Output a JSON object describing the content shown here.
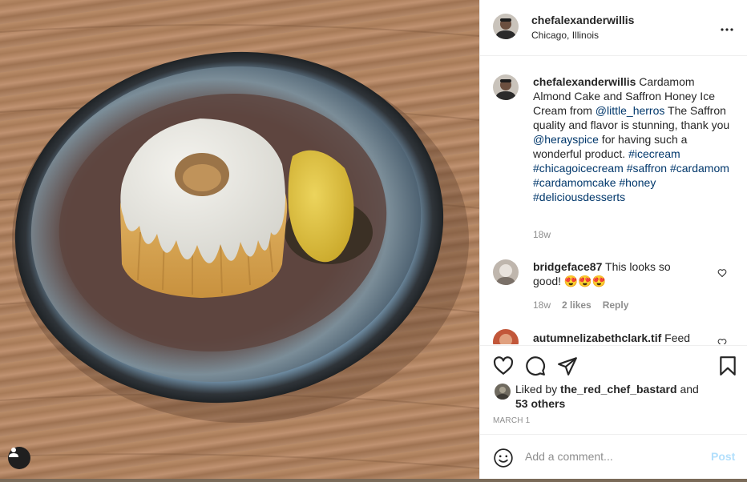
{
  "post": {
    "author": "chefalexanderwillis",
    "location": "Chicago, Illinois",
    "more_glyph": "•••"
  },
  "caption": {
    "author": "chefalexanderwillis",
    "text_1": " Cardamom Almond Cake and Saffron Honey Ice Cream from ",
    "mention_1": "@little_herros",
    "text_2": " The Saffron quality and flavor is stunning, thank you ",
    "mention_2": "@herayspice",
    "text_3": " for having such a wonderful product. ",
    "hashtags": [
      "#icecream",
      "#chicagoicecream",
      "#saffron",
      "#cardamom",
      "#cardamomcake",
      "#honey",
      "#deliciousdesserts"
    ],
    "time": "18w"
  },
  "comments": [
    {
      "author": "bridgeface87",
      "text": " This looks so good! 😍😍😍",
      "time": "18w",
      "likes": "2 likes",
      "reply": "Reply"
    },
    {
      "author": "autumnelizabethclark.tif",
      "text": " Feed"
    }
  ],
  "likes": {
    "prefix": "Liked by ",
    "user": "the_red_chef_bastard",
    "middle": " and",
    "others": "53 others"
  },
  "date": "MARCH 1",
  "composer": {
    "placeholder": "Add a comment...",
    "post_label": "Post"
  },
  "colors": {
    "link": "#00376b",
    "post_disabled": "#b2dffc",
    "muted": "#8e8e8e"
  },
  "icons": [
    "user-tag-icon",
    "more-options-icon",
    "like-icon",
    "comment-icon",
    "share-icon",
    "save-icon",
    "emoji-icon",
    "small-heart-icon"
  ]
}
